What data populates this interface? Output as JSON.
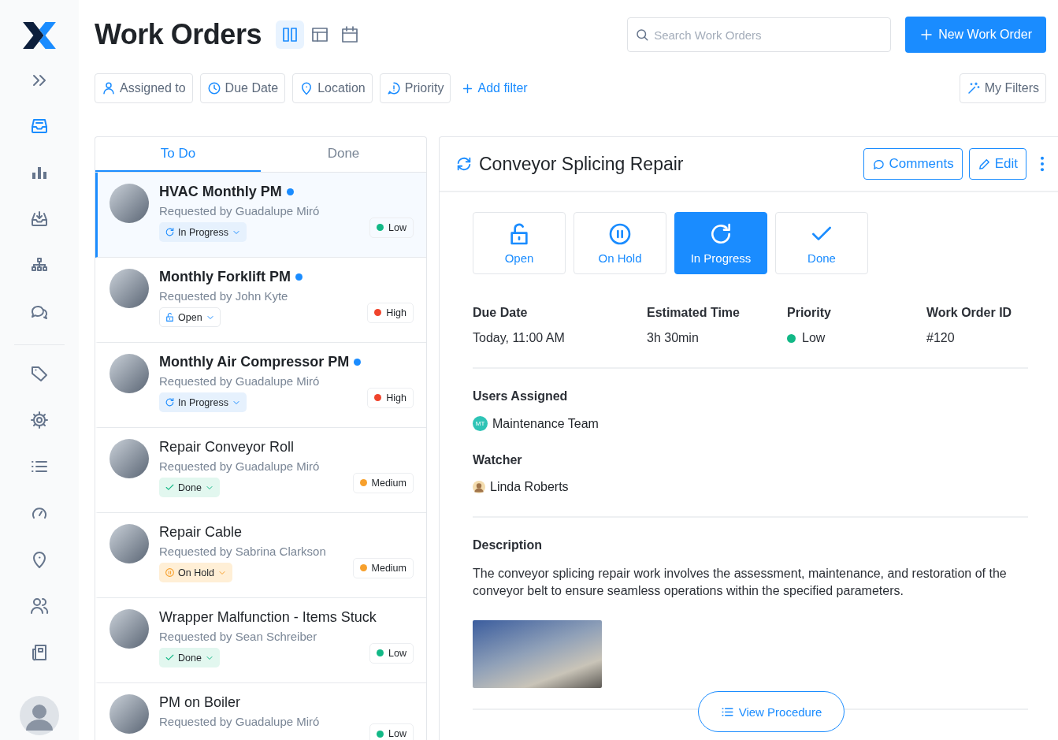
{
  "sidebar": {
    "items": [
      {
        "kind": "tray",
        "selected": true
      },
      {
        "kind": "chart",
        "selected": false
      },
      {
        "kind": "download",
        "selected": false
      },
      {
        "kind": "hierarchy",
        "selected": false
      },
      {
        "kind": "chat",
        "selected": false
      },
      {
        "kind": "tag",
        "selected": false
      },
      {
        "kind": "gear",
        "selected": false
      },
      {
        "kind": "list",
        "selected": false
      },
      {
        "kind": "gauge",
        "selected": false
      },
      {
        "kind": "pin",
        "selected": false
      },
      {
        "kind": "users",
        "selected": false
      },
      {
        "kind": "book",
        "selected": false
      }
    ]
  },
  "header": {
    "title": "Work Orders",
    "views": [
      {
        "kind": "columns",
        "selected": true
      },
      {
        "kind": "layout",
        "selected": false
      },
      {
        "kind": "calendar",
        "selected": false
      }
    ],
    "search": {
      "placeholder": "Search Work Orders"
    },
    "new_button": "New Work Order"
  },
  "filters": {
    "items": [
      {
        "kind": "person",
        "label": "Assigned to"
      },
      {
        "kind": "clock",
        "label": "Due Date"
      },
      {
        "kind": "pin",
        "label": "Location"
      },
      {
        "kind": "alert",
        "label": "Priority"
      }
    ],
    "add_filter": "Add filter",
    "my_filters": "My Filters"
  },
  "list": {
    "tabs": [
      {
        "label": "To Do",
        "selected": true
      },
      {
        "label": "Done",
        "selected": false
      }
    ],
    "orders": [
      {
        "title": "HVAC Monthly PM",
        "unread": true,
        "requester": "Requested by Guadalupe Miró",
        "status": {
          "kind": "in_progress",
          "label": "In Progress"
        },
        "priority": {
          "label": "Low",
          "color": "#12b886"
        },
        "selected": true
      },
      {
        "title": "Monthly Forklift PM",
        "unread": true,
        "requester": "Requested by John Kyte",
        "status": {
          "kind": "open",
          "label": "Open"
        },
        "priority": {
          "label": "High",
          "color": "#f0442c"
        },
        "selected": false
      },
      {
        "title": "Monthly Air Compressor PM",
        "unread": true,
        "requester": "Requested by Guadalupe Miró",
        "status": {
          "kind": "in_progress",
          "label": "In Progress"
        },
        "priority": {
          "label": "High",
          "color": "#f0442c"
        },
        "selected": false
      },
      {
        "title": "Repair Conveyor Roll",
        "unread": false,
        "requester": "Requested by Guadalupe Miró",
        "status": {
          "kind": "done",
          "label": "Done"
        },
        "priority": {
          "label": "Medium",
          "color": "#f7a02c"
        },
        "selected": false
      },
      {
        "title": "Repair Cable",
        "unread": false,
        "requester": "Requested by Sabrina Clarkson",
        "status": {
          "kind": "on_hold",
          "label": "On Hold"
        },
        "priority": {
          "label": "Medium",
          "color": "#f7a02c"
        },
        "selected": false
      },
      {
        "title": "Wrapper Malfunction - Items Stuck",
        "unread": false,
        "requester": "Requested by Sean Schreiber",
        "status": {
          "kind": "done",
          "label": "Done"
        },
        "priority": {
          "label": "Low",
          "color": "#12b886"
        },
        "selected": false
      },
      {
        "title": "PM on Boiler",
        "unread": false,
        "requester": "Requested by Guadalupe Miró",
        "priority": {
          "label": "Low",
          "color": "#12b886"
        },
        "selected": false
      }
    ]
  },
  "detail": {
    "title": "Conveyor Splicing Repair",
    "comments_button": "Comments",
    "edit_button": "Edit",
    "statuses": [
      {
        "kind": "open",
        "label": "Open",
        "selected": false
      },
      {
        "kind": "on_hold",
        "label": "On Hold",
        "selected": false
      },
      {
        "kind": "in_progress",
        "label": "In Progress",
        "selected": true
      },
      {
        "kind": "done",
        "label": "Done",
        "selected": false
      }
    ],
    "fields": [
      {
        "label": "Due Date",
        "value": "Today, 11:00 AM"
      },
      {
        "label": "Estimated Time",
        "value": "3h 30min"
      },
      {
        "label": "Priority",
        "value": "Low",
        "color": "#12b886"
      },
      {
        "label": "Work Order ID",
        "value": "#120"
      }
    ],
    "users_assigned": {
      "heading": "Users Assigned",
      "initials": "MT",
      "name": "Maintenance Team"
    },
    "watcher": {
      "heading": "Watcher",
      "name": "Linda Roberts"
    },
    "description": {
      "heading": "Description",
      "text": "The conveyor splicing repair work involves the assessment, maintenance, and restoration of the conveyor belt to ensure seamless operations within the specified parameters."
    },
    "view_procedure": "View Procedure"
  }
}
